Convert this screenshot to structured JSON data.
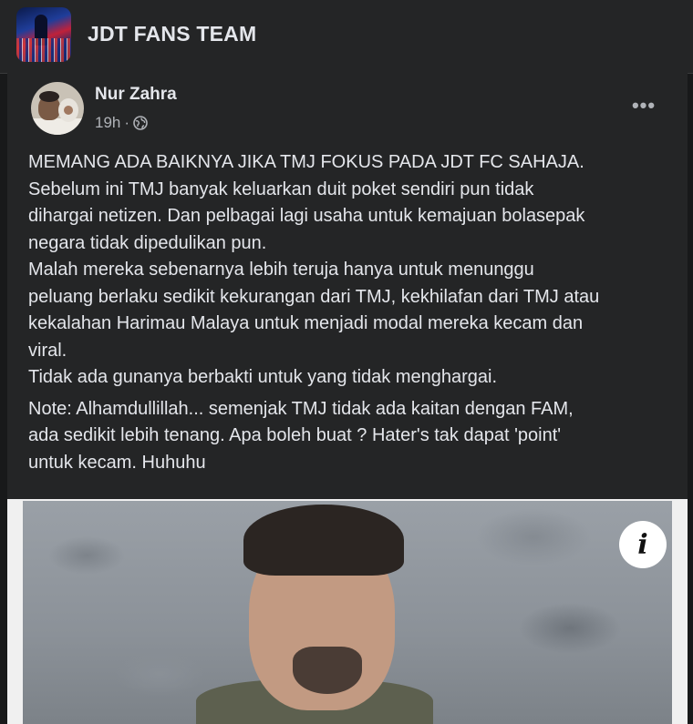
{
  "group": {
    "name": "JDT FANS TEAM"
  },
  "post": {
    "author": "Nur Zahra",
    "time": "19h",
    "separator": "·",
    "more_label": "•••",
    "text_lines": [
      "MEMANG ADA BAIKNYA JIKA TMJ FOKUS PADA JDT FC SAHAJA.",
      "Sebelum ini TMJ banyak keluarkan duit poket sendiri pun tidak",
      "dihargai netizen. Dan pelbagai lagi usaha untuk kemajuan bolasepak",
      "negara tidak dipedulikan pun.",
      "Malah mereka sebenarnya lebih teruja hanya untuk menunggu",
      "peluang berlaku sedikit kekurangan dari TMJ, kekhilafan dari TMJ atau",
      "kekalahan Harimau Malaya untuk menjadi modal mereka kecam dan",
      "viral.",
      "Tidak ada gunanya berbakti untuk yang tidak menghargai."
    ],
    "note_lines": [
      "Note: Alhamdullillah... semenjak TMJ tidak ada kaitan dengan FAM,",
      "ada sedikit lebih tenang. Apa boleh buat ? Hater's tak dapat 'point'",
      "untuk kecam. Huhuhu"
    ],
    "info_label": "i"
  },
  "colors": {
    "background": "#18191a",
    "card": "#242526",
    "text_primary": "#e4e6eb",
    "text_secondary": "#b0b3b8"
  },
  "icons": {
    "privacy": "globe-icon",
    "menu": "more-icon",
    "info": "info-icon"
  }
}
